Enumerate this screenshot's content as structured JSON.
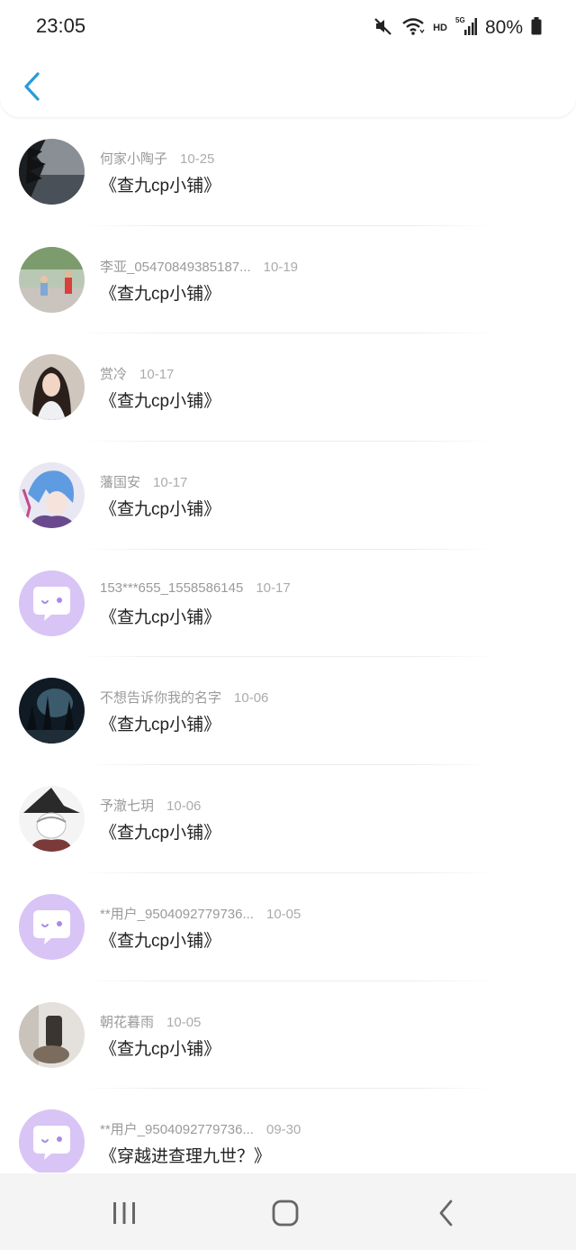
{
  "status_bar": {
    "time": "23:05",
    "network_type": "HD",
    "signal_label": "5G",
    "battery_text": "80%"
  },
  "comments": [
    {
      "username": "何家小陶子",
      "date": "10-25",
      "content": "《查九cp小铺》",
      "avatar": "landscape-tree"
    },
    {
      "username": "李亚_05470849385187...",
      "date": "10-19",
      "content": "《查九cp小铺》",
      "avatar": "kids-photo"
    },
    {
      "username": "赏冷",
      "date": "10-17",
      "content": "《查九cp小铺》",
      "avatar": "girl-photo"
    },
    {
      "username": "藩国安",
      "date": "10-17",
      "content": "《查九cp小铺》",
      "avatar": "anime-blue-hair"
    },
    {
      "username": "153***655_1558586145",
      "date": "10-17",
      "content": "《查九cp小铺》",
      "avatar": "default-chat"
    },
    {
      "username": "不想告诉你我的名字",
      "date": "10-06",
      "content": "《查九cp小铺》",
      "avatar": "night-forest"
    },
    {
      "username": "予澈七玥",
      "date": "10-06",
      "content": "《查九cp小铺》",
      "avatar": "anime-witch-hat"
    },
    {
      "username": "**用户_9504092779736...",
      "date": "10-05",
      "content": "《查九cp小铺》",
      "avatar": "default-chat"
    },
    {
      "username": "朝花暮雨",
      "date": "10-05",
      "content": "《查九cp小铺》",
      "avatar": "room-photo"
    },
    {
      "username": "**用户_9504092779736...",
      "date": "09-30",
      "content": "《穿越进查理九世？》",
      "avatar": "default-chat"
    }
  ],
  "colors": {
    "accent": "#2a9bd8",
    "default_avatar_bg": "#d8c4f5",
    "default_avatar_face": "#a98ae8"
  }
}
